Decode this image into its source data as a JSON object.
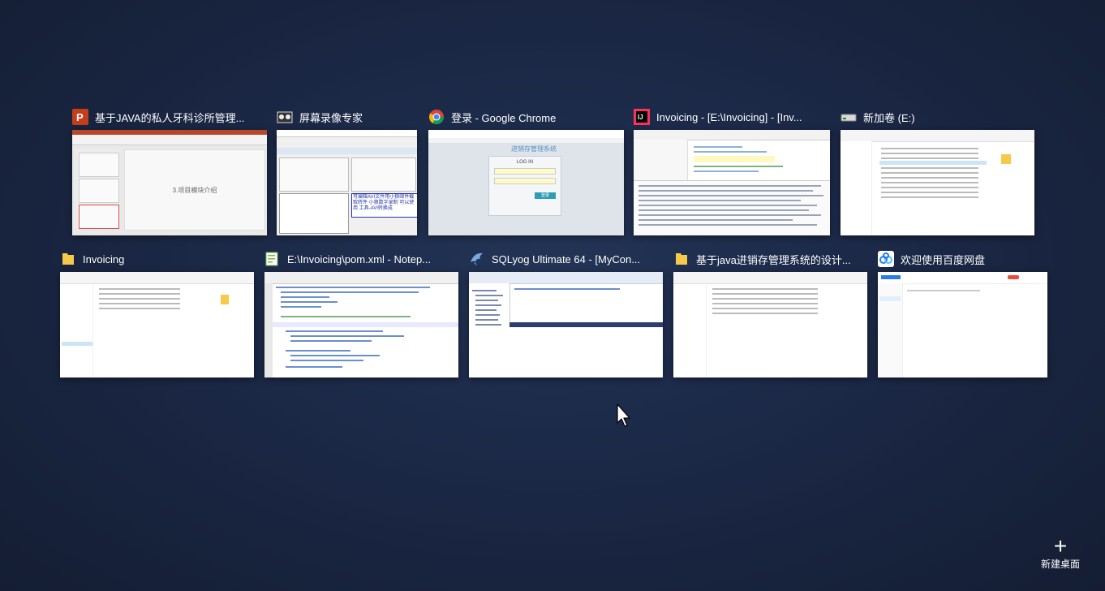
{
  "task_view": {
    "row1": [
      {
        "title": "基于JAVA的私人牙科诊所管理...",
        "icon": "powerpoint-icon",
        "slide_text": "3.项目模块介绍"
      },
      {
        "title": "屏幕录像专家",
        "icon": "screen-recorder-icon",
        "banner_text": "可编辑AVI文件用小狼邮件截取转件 小狼数字录制 可以使用 工具-AVI转换成"
      },
      {
        "title": "登录 - Google Chrome",
        "icon": "chrome-icon",
        "page_heading": "进销存管理系统",
        "login_label": "LOG IN",
        "button_label": "登录"
      },
      {
        "title": "Invoicing - [E:\\Invoicing] - [Inv...",
        "icon": "intellij-icon"
      },
      {
        "title": "新加卷 (E:)",
        "icon": "drive-icon"
      }
    ],
    "row2": [
      {
        "title": "Invoicing",
        "icon": "folder-icon"
      },
      {
        "title": "E:\\Invoicing\\pom.xml - Notep...",
        "icon": "notepad-icon"
      },
      {
        "title": "SQLyog Ultimate 64 - [MyCon...",
        "icon": "sqlyog-icon"
      },
      {
        "title": "基于java进销存管理系统的设计...",
        "icon": "folder-icon"
      },
      {
        "title": "欢迎使用百度网盘",
        "icon": "baidu-netdisk-icon"
      }
    ]
  },
  "new_desktop": {
    "label": "新建桌面",
    "icon": "plus-icon"
  },
  "colors": {
    "background": "#1b2846",
    "ppt": "#c43e1c",
    "chrome_blue": "#4285f4",
    "baidu": "#2c7be5"
  }
}
